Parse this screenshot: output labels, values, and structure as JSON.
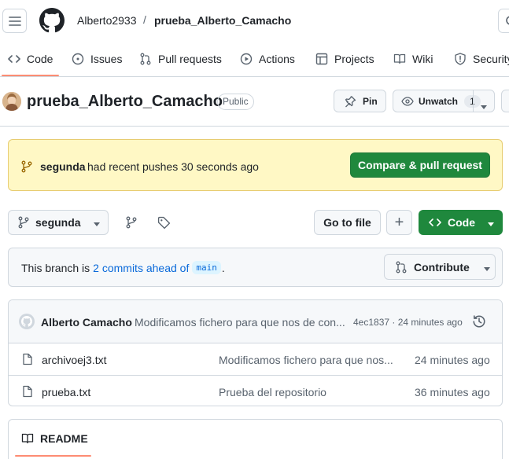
{
  "header": {
    "owner": "Alberto2933",
    "separator": "/",
    "repo": "prueba_Alberto_Camacho"
  },
  "tabs": [
    {
      "label": "Code",
      "icon": "code-icon",
      "active": true
    },
    {
      "label": "Issues",
      "icon": "issue-opened-icon"
    },
    {
      "label": "Pull requests",
      "icon": "git-pull-request-icon"
    },
    {
      "label": "Actions",
      "icon": "play-icon"
    },
    {
      "label": "Projects",
      "icon": "table-icon"
    },
    {
      "label": "Wiki",
      "icon": "book-icon"
    },
    {
      "label": "Security",
      "icon": "shield-icon"
    }
  ],
  "repo_header": {
    "name": "prueba_Alberto_Camacho",
    "visibility": "Public",
    "pin_label": "Pin",
    "watch_label": "Unwatch",
    "watch_count": "1"
  },
  "push_banner": {
    "branch": "segunda",
    "message": "had recent pushes 30 seconds ago",
    "button": "Compare & pull request"
  },
  "toolbar": {
    "branch": "segunda",
    "go_to_file": "Go to file",
    "add": "+",
    "code": "Code"
  },
  "branch_info": {
    "prefix": "This branch is",
    "ahead": "2 commits ahead of",
    "base": "main",
    "suffix": ".",
    "contribute": "Contribute"
  },
  "commit": {
    "author": "Alberto Camacho",
    "message": "Modificamos fichero para que nos de con...",
    "meta": "4ec1837 · 24 minutes ago"
  },
  "files": [
    {
      "name": "archivoej3.txt",
      "message": "Modificamos fichero para que nos...",
      "time": "24 minutes ago"
    },
    {
      "name": "prueba.txt",
      "message": "Prueba del repositorio",
      "time": "36 minutes ago"
    }
  ],
  "readme": {
    "label": "README"
  },
  "colors": {
    "accent_green": "#1f883d",
    "active_tab_underline": "#fd8c73",
    "banner_bg": "#fff8c5",
    "banner_border": "#d4a72c",
    "link": "#0969da"
  }
}
